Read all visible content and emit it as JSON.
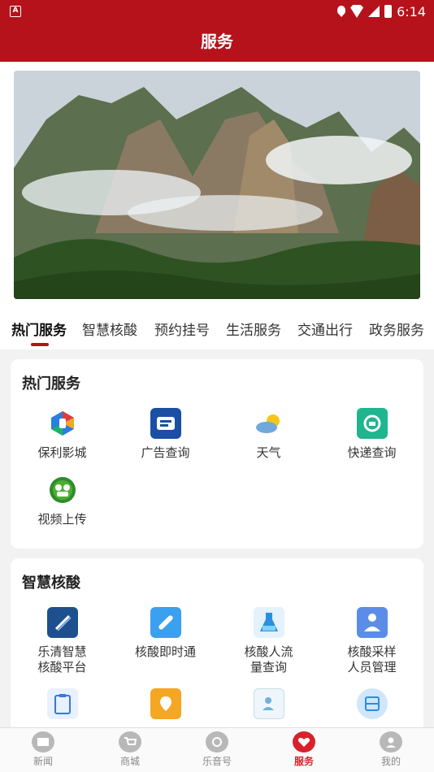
{
  "status_bar": {
    "time": "6:14",
    "left_badge": "A"
  },
  "header": {
    "title": "服务"
  },
  "tabs": [
    {
      "label": "热门服务",
      "active": true
    },
    {
      "label": "智慧核酸",
      "active": false
    },
    {
      "label": "预约挂号",
      "active": false
    },
    {
      "label": "生活服务",
      "active": false
    },
    {
      "label": "交通出行",
      "active": false
    },
    {
      "label": "政务服务",
      "active": false
    }
  ],
  "hot_services": {
    "title": "热门服务",
    "items": [
      {
        "label": "保利影城",
        "icon": "poly-cinema-icon"
      },
      {
        "label": "广告查询",
        "icon": "ad-query-icon"
      },
      {
        "label": "天气",
        "icon": "weather-icon"
      },
      {
        "label": "快递查询",
        "icon": "express-query-icon"
      },
      {
        "label": "视频上传",
        "icon": "video-upload-icon"
      }
    ]
  },
  "smart_nucleic": {
    "title": "智慧核酸",
    "items": [
      {
        "label": "乐清智慧\n核酸平台",
        "icon": "nucleic-platform-icon"
      },
      {
        "label": "核酸即时通",
        "icon": "nucleic-instant-icon"
      },
      {
        "label": "核酸人流\n量查询",
        "icon": "flask-icon"
      },
      {
        "label": "核酸采样\n人员管理",
        "icon": "staff-management-icon"
      },
      {
        "label": "",
        "icon": "clipboard-icon"
      },
      {
        "label": "",
        "icon": "map-icon"
      },
      {
        "label": "",
        "icon": "user-check-icon"
      },
      {
        "label": "",
        "icon": "scan-icon"
      }
    ]
  },
  "bottom_nav": [
    {
      "label": "新闻",
      "icon": "news-icon",
      "active": false
    },
    {
      "label": "商城",
      "icon": "cart-icon",
      "active": false
    },
    {
      "label": "乐音号",
      "icon": "phone-icon",
      "active": false
    },
    {
      "label": "服务",
      "icon": "heart-hand-icon",
      "active": true
    },
    {
      "label": "我的",
      "icon": "profile-icon",
      "active": false
    }
  ],
  "colors": {
    "brand": "#b5121b",
    "active_nav": "#d8222b"
  }
}
